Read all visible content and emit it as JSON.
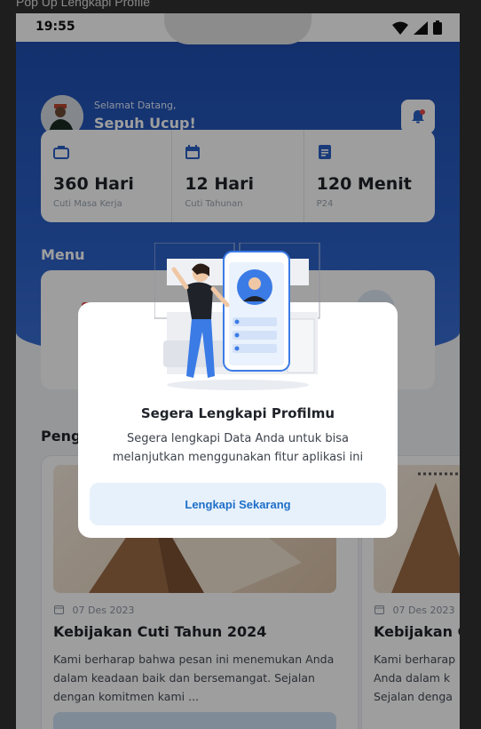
{
  "window_title": "Pop Up Lengkapi Profile",
  "status_bar": {
    "time": "19:55"
  },
  "header": {
    "greeting": "Selamat Datang,",
    "name": "Sepuh Ucup!"
  },
  "stats": [
    {
      "value": "360 Hari",
      "label": "Cuti Masa Kerja",
      "icon": "briefcase-icon"
    },
    {
      "value": "12 Hari",
      "label": "Cuti Tahunan",
      "icon": "calendar-icon"
    },
    {
      "value": "120 Menit",
      "label": "P24",
      "icon": "document-icon"
    }
  ],
  "menu": {
    "title": "Menu"
  },
  "announcements": {
    "title": "Peng",
    "cards": [
      {
        "date": "07 Des 2023",
        "title": "Kebijakan Cuti Tahun 2024",
        "body": "Kami berharap bahwa pesan ini menemukan Anda dalam keadaan baik dan bersemangat. Sejalan dengan komitmen kami ..."
      },
      {
        "date": "07 Des 2023",
        "title": "Kebijakan C",
        "body": "Kami berharap Anda dalam k Sejalan denga"
      }
    ]
  },
  "modal": {
    "title": "Segera Lengkapi Profilmu",
    "description": "Segera lengkapi Data Anda untuk bisa melanjutkan menggunakan fitur aplikasi ini",
    "button_label": "Lengkapi Sekarang"
  },
  "colors": {
    "primary": "#1f4eb0",
    "accent": "#1e6fc8",
    "bell_dot": "#e5484d"
  }
}
